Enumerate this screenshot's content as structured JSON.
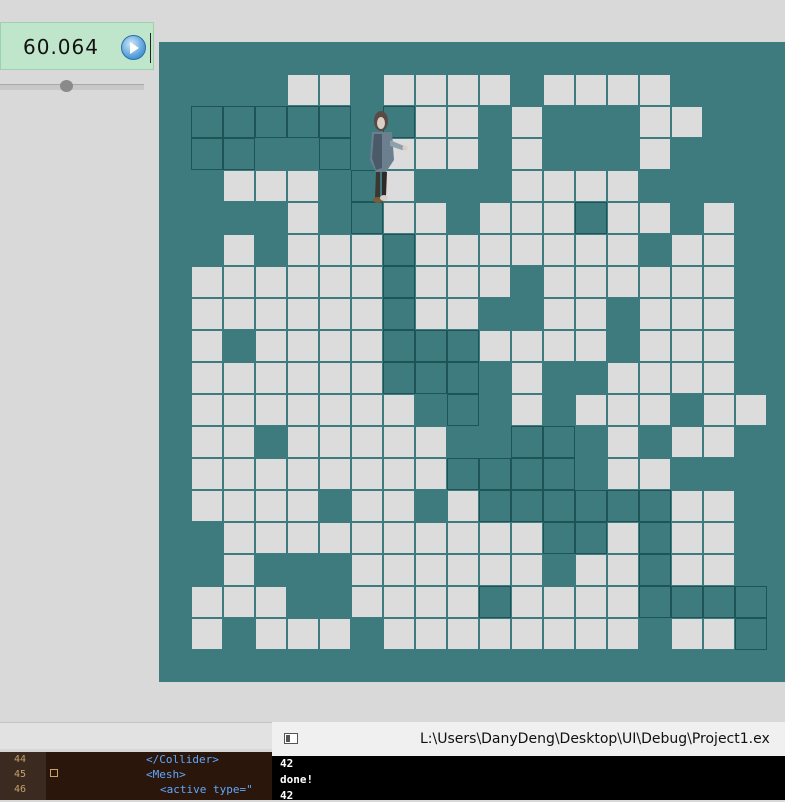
{
  "fps_panel": {
    "value": "60.064",
    "play_icon": "play-icon"
  },
  "slider": {
    "level": 0.46
  },
  "colors": {
    "background": "#d9d9d9",
    "board": "#3e7b7e",
    "tile": "#dcdcdc",
    "tile_border": "#3e7b7e",
    "path_border": "#1f5456",
    "panel": "#bfe6cb"
  },
  "board": {
    "cols": 19,
    "rows": 18,
    "legend": "W = light tile, D = outlined dark path cell, . = open teal",
    "map": [
      "...................",
      "....WW.WWWW.WWWW...",
      ".DDDDD.DWW.W...WW..",
      ".DD..D.WWW.W...W...",
      "..WWW.DW...WWWW....",
      "....W.DWW.WWWDWW.W.",
      "..W.WWWDWWWWWWW.WW.",
      ".WWWWWWDWWW.WWWWWW.",
      ".WWWWWWDWW..WW.WWW.",
      ".W.WWWWDDDWWWW.WWW.",
      ".WWWWWWDDD.W..WWWW.",
      ".WWWWWWW.D.W.WWW.WW",
      ".WW.WWWWW..DD.W.WW.",
      ".WWWWWWWWDDDD.WW...",
      ".WWWW.WW.WDDDDDDWW.",
      "..WWWWWWWWWWDDWDWW.",
      "..W...WWWWWW.WWDWW.",
      ".WWW..WWWWDWWWWDDDD",
      ".W.WWW.WWWWWWWW.WWD"
    ]
  },
  "character": {
    "icon": "zombie-icon"
  },
  "editor": {
    "lines": [
      {
        "num": "44",
        "code": "</Collider>",
        "indent": 1
      },
      {
        "num": "45",
        "code": "<Mesh>",
        "indent": 1
      },
      {
        "num": "46",
        "code": "<active type=\"",
        "indent": 2
      }
    ]
  },
  "console": {
    "window_icon": "console-window-icon",
    "title": "L:\\Users\\DanyDeng\\Desktop\\UI\\Debug\\Project1.ex",
    "output": [
      "42",
      "done!",
      "42"
    ]
  }
}
